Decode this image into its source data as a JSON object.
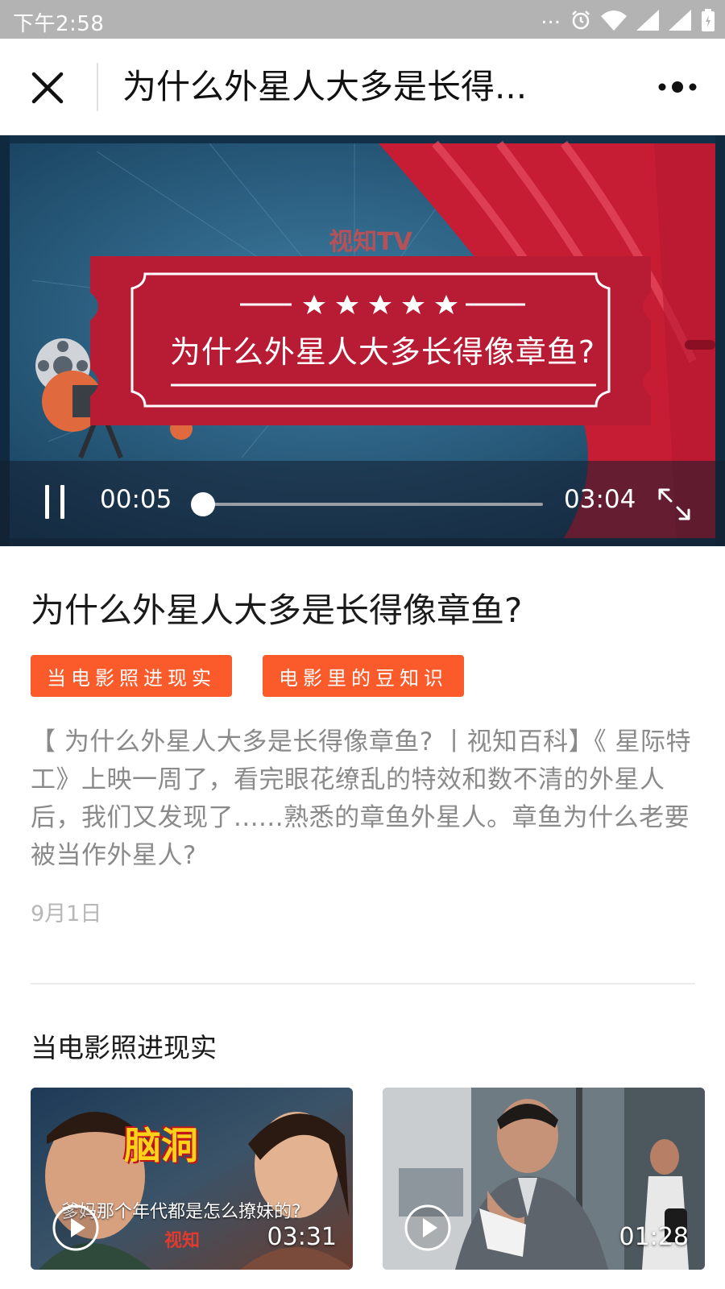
{
  "status_bar": {
    "time": "下午2:58",
    "dots": "...",
    "icons": [
      "alarm-icon",
      "wifi-icon",
      "signal-icon",
      "signal-icon",
      "battery-icon"
    ]
  },
  "nav": {
    "title": "为什么外星人大多是长得...",
    "close_icon": "close-icon",
    "more_icon": "more-dots-icon"
  },
  "video": {
    "watermark_logo": "视知TV",
    "ticket_title": "为什么外星人大多长得像章鱼?",
    "current_time": "00:05",
    "total_time": "03:04",
    "progress": 0.027,
    "colors": {
      "curtain": "#c61d35",
      "ticket": "#b71c34",
      "background": "#1f5679"
    }
  },
  "article": {
    "title": "为什么外星人大多是长得像章鱼?",
    "tags": [
      "当电影照进现实",
      "电影里的豆知识"
    ],
    "description": "【 为什么外星人大多是长得像章鱼? 丨视知百科】《 星际特工》上映一周了，看完眼花缭乱的特效和数不清的外星人后，我们又发现了......熟悉的章鱼外星人。章鱼为什么老要被当作外星人?",
    "date": "9月1日"
  },
  "related": {
    "section_title": "当电影照进现实",
    "cards": [
      {
        "logo_text": "脑洞",
        "caption": "爹妈那个年代都是怎么撩妹的?",
        "watermark": "视知",
        "duration": "03:31"
      },
      {
        "duration": "01:28"
      }
    ]
  },
  "accent_color": "#fb5a2a"
}
